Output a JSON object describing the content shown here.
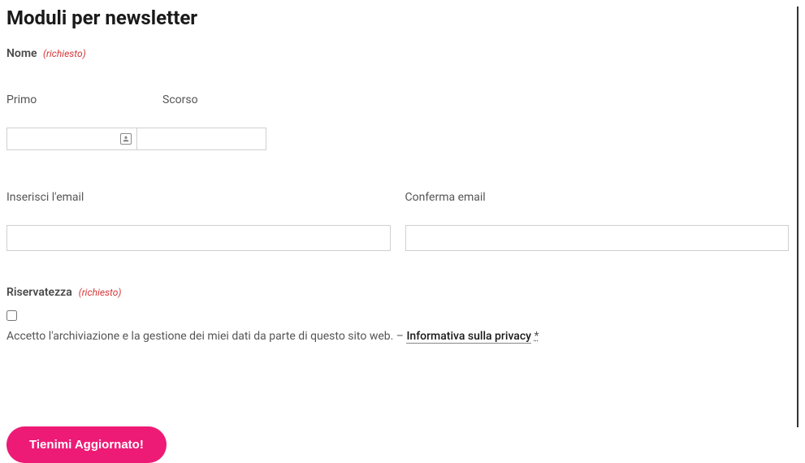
{
  "heading": "Moduli per newsletter",
  "name": {
    "label": "Nome",
    "required": "(richiesto)",
    "first_label": "Primo",
    "last_label": "Scorso",
    "first_value": "",
    "last_value": ""
  },
  "email": {
    "enter_label": "Inserisci l'email",
    "confirm_label": "Conferma email",
    "enter_value": "",
    "confirm_value": ""
  },
  "privacy": {
    "label": "Riservatezza",
    "required": "(richiesto)",
    "text_prefix": "Accetto l'archiviazione e la gestione dei miei dati da parte di questo sito web. – ",
    "link_text": "Informativa sulla privacy",
    "asterisk": "*"
  },
  "submit": {
    "label": "Tienimi Aggiornato!"
  }
}
